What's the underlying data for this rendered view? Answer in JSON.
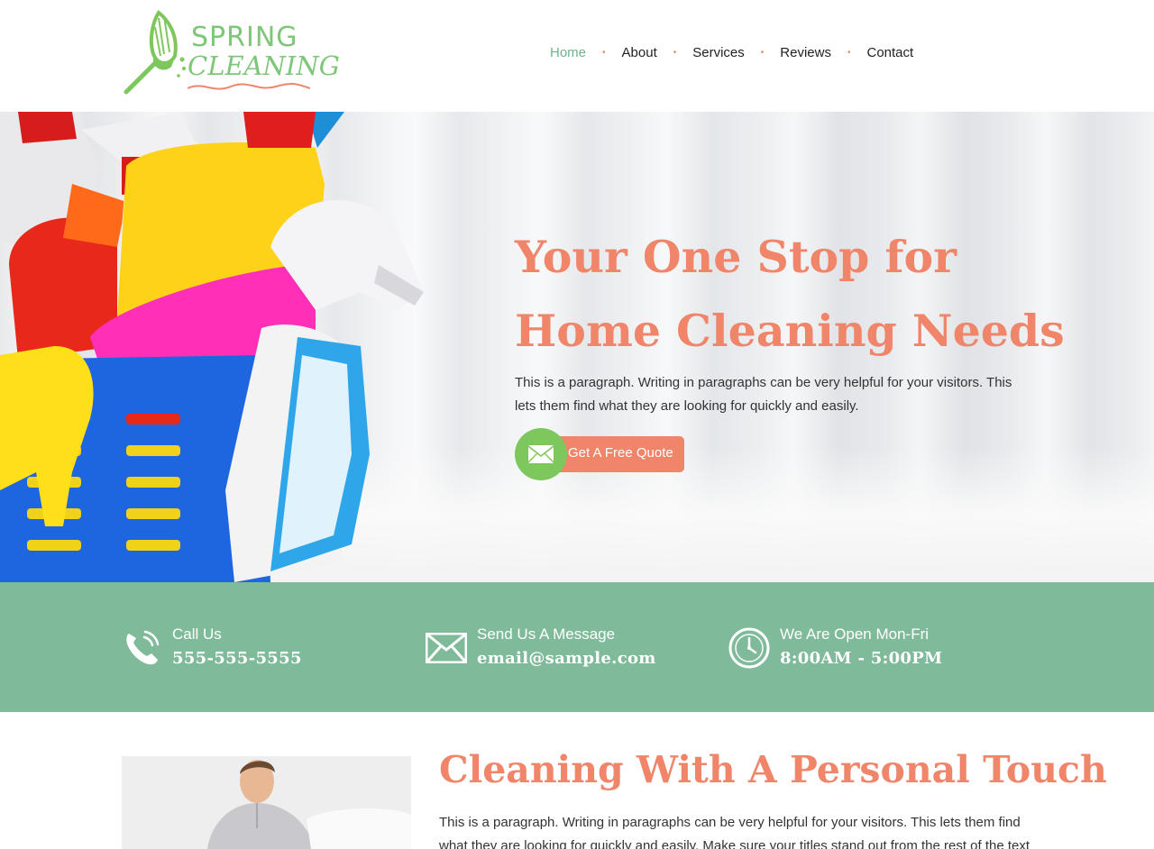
{
  "brand": {
    "logo_line1": "SPRING",
    "logo_line2": "CLEANING",
    "primary_color": "#7ec779",
    "accent_color": "#f0856a",
    "band_color": "#7fbb9a"
  },
  "nav": {
    "items": [
      {
        "label": "Home",
        "active": true
      },
      {
        "label": "About",
        "active": false
      },
      {
        "label": "Services",
        "active": false
      },
      {
        "label": "Reviews",
        "active": false
      },
      {
        "label": "Contact",
        "active": false
      }
    ]
  },
  "hero": {
    "title_line1": "Your One Stop for",
    "title_line2": "Home Cleaning Needs",
    "paragraph": "This is a paragraph. Writing in paragraphs can be very helpful for your visitors. This lets them find what they are looking for quickly and easily.",
    "cta_label": "Get A Free Quote",
    "cta_icon": "envelope-icon"
  },
  "info": {
    "call": {
      "label": "Call Us",
      "value": "555-555-5555",
      "icon": "phone-icon"
    },
    "message": {
      "label": "Send Us A Message",
      "value": "email@sample.com",
      "icon": "envelope-icon"
    },
    "hours": {
      "label": "We Are Open Mon-Fri",
      "value": "8:00AM - 5:00PM",
      "icon": "clock-icon"
    }
  },
  "about": {
    "title": "Cleaning With A Personal Touch",
    "paragraph": "This is a paragraph. Writing in paragraphs can be very helpful for your visitors. This lets them find what they are looking for quickly and easily. Make sure your titles stand out from the rest of the text and that"
  }
}
